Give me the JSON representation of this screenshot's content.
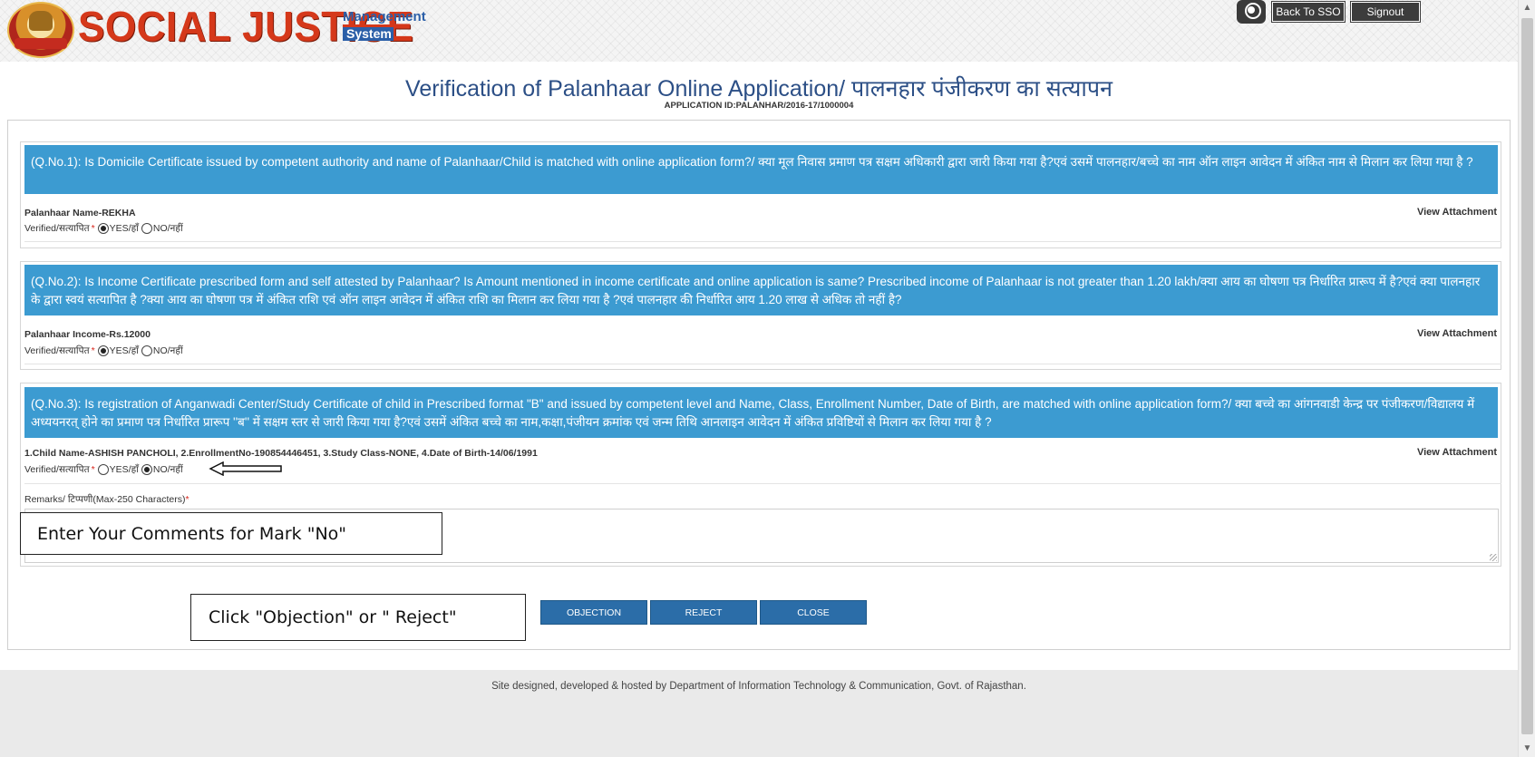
{
  "header": {
    "logo_title": "SOCIAL JUSTICE",
    "logo_sub_management": "Management",
    "logo_sub_system": "System",
    "back_to_sso": "Back To SSO",
    "signout": "Signout"
  },
  "page": {
    "title": "Verification of Palanhaar Online Application/ पालनहार पंजीकरण का सत्यापन",
    "application_id": "APPLICATION ID:PALANHAR/2016-17/1000004"
  },
  "questions": [
    {
      "text": "(Q.No.1): Is Domicile Certificate issued by competent authority and name of Palanhaar/Child is matched with online application form?/ क्या मूल निवास प्रमाण पत्र सक्षम अधिकारी द्वारा जारी किया गया है?एवं उसमें पालनहार/बच्चे का नाम ऑन लाइन आवेदन में अंकित नाम से मिलान कर लिया गया है ?",
      "field": "Palanhaar Name-REKHA",
      "view_attachment": "View Attachment",
      "verified_label": "Verified/सत्यापित",
      "required": "*",
      "yes_label": "YES/हाँ",
      "no_label": "NO/नहीं",
      "selected": "yes"
    },
    {
      "text": "(Q.No.2): Is Income Certificate prescribed form and self attested by Palanhaar? Is Amount mentioned in income certificate and online application is same? Prescribed income of Palanhaar is not greater than 1.20 lakh/क्या आय का घोषणा पत्र निर्धारित प्रारूप में है?एवं क्या पालनहार के द्वारा स्वयं सत्यापित है ?क्या आय का घोषणा पत्र में अंकित राशि एवं ऑन लाइन आवेदन में अंकित राशि का मिलान कर लिया गया है ?एवं पालनहार की निर्धारित आय 1.20 लाख से अधिक तो नहीं है?",
      "field": "Palanhaar Income-Rs.12000",
      "view_attachment": "View Attachment",
      "verified_label": "Verified/सत्यापित",
      "required": "*",
      "yes_label": "YES/हाँ",
      "no_label": "NO/नहीं",
      "selected": "yes"
    },
    {
      "text": "(Q.No.3): Is registration of Anganwadi Center/Study Certificate of child in Prescribed format \"B\" and issued by competent level and Name, Class, Enrollment Number, Date of Birth, are matched with online application form?/ क्या बच्चे का आंगनवाडी केन्द्र पर पंजीकरण/विद्यालय में अध्ययनरत् होने का प्रमाण पत्र निर्धारित प्रारूप ''ब'' में सक्षम स्तर से जारी किया गया है?एवं उसमें अंकित बच्चे का नाम,कक्षा,पंजीयन क्रमांक एवं जन्म तिथि आनलाइन आवेदन में अंकित प्रविष्टियों से मिलान कर लिया गया है ?",
      "field": "1.Child Name-ASHISH PANCHOLI, 2.EnrollmentNo-190854446451, 3.Study Class-NONE, 4.Date of Birth-14/06/1991",
      "view_attachment": "View Attachment",
      "verified_label": "Verified/सत्यापित",
      "required": "*",
      "yes_label": "YES/हाँ",
      "no_label": "NO/नहीं",
      "selected": "no"
    }
  ],
  "remarks": {
    "label": "Remarks/ टिप्पणी(Max-250 Characters)",
    "required": "*",
    "value": ""
  },
  "callouts": {
    "comments": "Enter Your Comments for Mark \"No\"",
    "reject": "Click \"Objection\" or \" Reject\""
  },
  "actions": {
    "objection": "OBJECTION",
    "reject": "REJECT",
    "close": "CLOSE"
  },
  "footer": {
    "text": "Site designed, developed & hosted by Department of Information Technology & Communication, Govt. of Rajasthan."
  },
  "icons": {
    "user": "user-icon",
    "scroll_up": "chevron-up-icon",
    "scroll_down": "chevron-down-icon",
    "arrow": "arrow-left-icon"
  },
  "colors": {
    "question_header_bg": "#3c9bd1",
    "button_bg": "#2b6da8",
    "title_color": "#2c4f86",
    "logo_red": "#d5381a"
  }
}
